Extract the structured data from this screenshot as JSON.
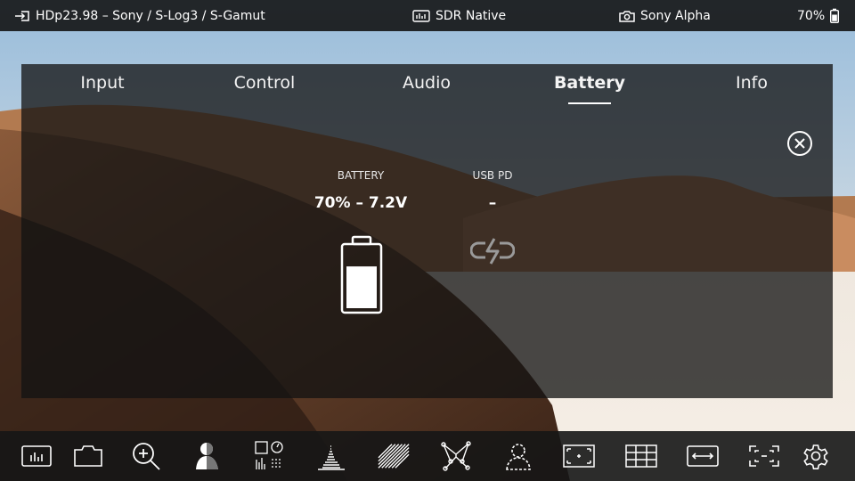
{
  "status_bar": {
    "input_source": "HDp23.98 – Sony / S-Log3 / S-Gamut",
    "display_mode": "SDR Native",
    "camera": "Sony Alpha",
    "battery_percent": "70%"
  },
  "tabs": [
    {
      "label": "Input"
    },
    {
      "label": "Control"
    },
    {
      "label": "Audio"
    },
    {
      "label": "Battery",
      "active": true
    },
    {
      "label": "Info"
    }
  ],
  "battery_panel": {
    "battery_label": "BATTERY",
    "battery_value": "70% – 7.2V",
    "battery_level": 0.7,
    "usb_label": "USB PD",
    "usb_value": "–"
  },
  "toolbar_icons": [
    "waveform-monitor-icon",
    "camera-bag-icon",
    "zoom-icon",
    "false-color-icon",
    "scopes-icon",
    "histogram-icon",
    "zebra-icon",
    "focus-assist-icon",
    "face-detect-icon",
    "frame-guides-icon",
    "grid-icon",
    "anamorphic-desqueeze-icon",
    "safe-area-icon",
    "settings-gear-icon"
  ]
}
